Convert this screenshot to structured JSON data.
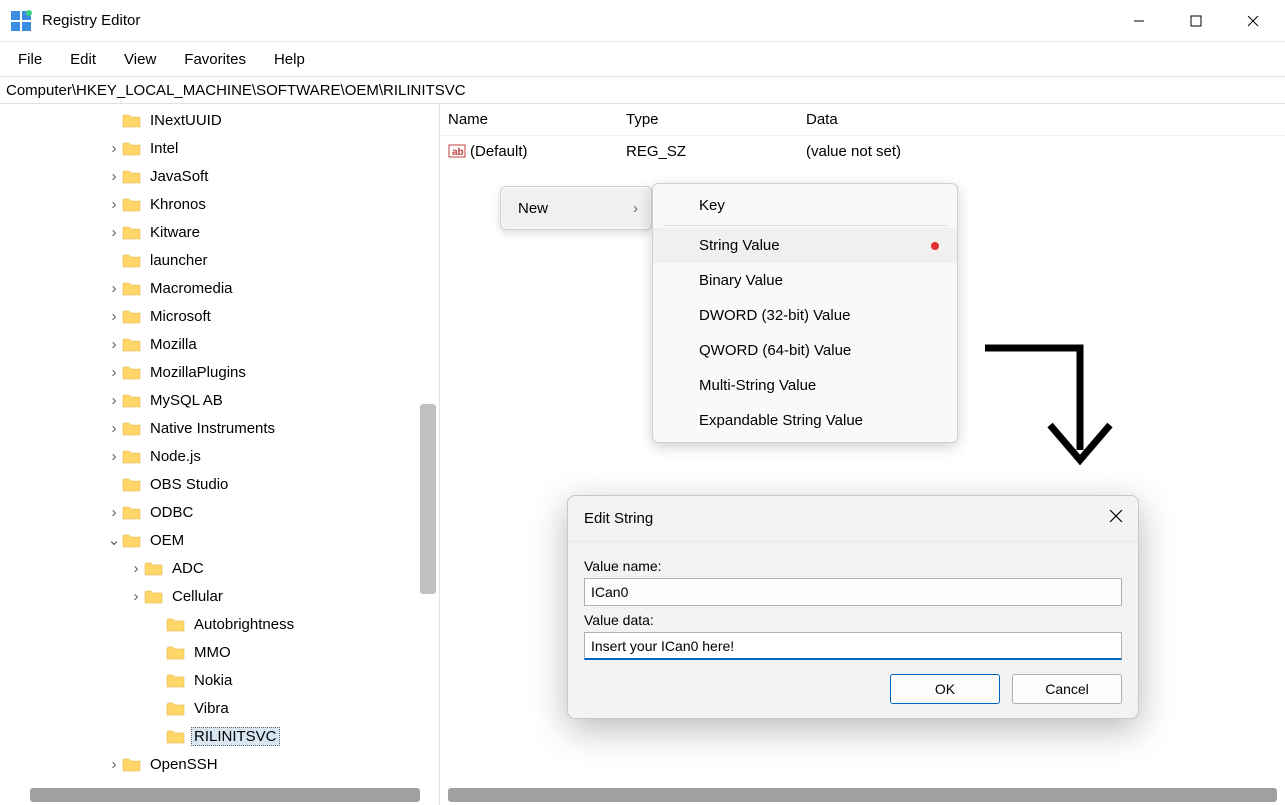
{
  "app": {
    "title": "Registry Editor"
  },
  "menu": {
    "file": "File",
    "edit": "Edit",
    "view": "View",
    "favorites": "Favorites",
    "help": "Help"
  },
  "addr": "Computer\\HKEY_LOCAL_MACHINE\\SOFTWARE\\OEM\\RILINITSVC",
  "tree": {
    "items": [
      {
        "label": "INextUUID",
        "indent": 3,
        "tw": ""
      },
      {
        "label": "Intel",
        "indent": 3,
        "tw": ">"
      },
      {
        "label": "JavaSoft",
        "indent": 3,
        "tw": ">"
      },
      {
        "label": "Khronos",
        "indent": 3,
        "tw": ">"
      },
      {
        "label": "Kitware",
        "indent": 3,
        "tw": ">"
      },
      {
        "label": "launcher",
        "indent": 3,
        "tw": ""
      },
      {
        "label": "Macromedia",
        "indent": 3,
        "tw": ">"
      },
      {
        "label": "Microsoft",
        "indent": 3,
        "tw": ">"
      },
      {
        "label": "Mozilla",
        "indent": 3,
        "tw": ">"
      },
      {
        "label": "MozillaPlugins",
        "indent": 3,
        "tw": ">"
      },
      {
        "label": "MySQL AB",
        "indent": 3,
        "tw": ">"
      },
      {
        "label": "Native Instruments",
        "indent": 3,
        "tw": ">"
      },
      {
        "label": "Node.js",
        "indent": 3,
        "tw": ">"
      },
      {
        "label": "OBS Studio",
        "indent": 3,
        "tw": ""
      },
      {
        "label": "ODBC",
        "indent": 3,
        "tw": ">"
      },
      {
        "label": "OEM",
        "indent": 3,
        "tw": "v"
      },
      {
        "label": "ADC",
        "indent": 4,
        "tw": ">"
      },
      {
        "label": "Cellular",
        "indent": 4,
        "tw": ">"
      },
      {
        "label": "Autobrightness",
        "indent": 5,
        "tw": ""
      },
      {
        "label": "MMO",
        "indent": 5,
        "tw": ""
      },
      {
        "label": "Nokia",
        "indent": 5,
        "tw": ""
      },
      {
        "label": "Vibra",
        "indent": 5,
        "tw": ""
      },
      {
        "label": "RILINITSVC",
        "indent": 5,
        "tw": "",
        "selected": true
      },
      {
        "label": "OpenSSH",
        "indent": 3,
        "tw": ">"
      }
    ]
  },
  "values": {
    "cols": {
      "name": "Name",
      "type": "Type",
      "data": "Data"
    },
    "rows": [
      {
        "name": "(Default)",
        "type": "REG_SZ",
        "data": "(value not set)"
      }
    ]
  },
  "ctx1": {
    "new": "New"
  },
  "ctx2": {
    "key": "Key",
    "string": "String Value",
    "binary": "Binary Value",
    "dword": "DWORD (32-bit) Value",
    "qword": "QWORD (64-bit) Value",
    "multi": "Multi-String Value",
    "expand": "Expandable String Value"
  },
  "dialog": {
    "title": "Edit String",
    "vname_label": "Value name:",
    "vname": "ICan0",
    "vdata_label": "Value data:",
    "vdata": "Insert your ICan0 here!",
    "ok": "OK",
    "cancel": "Cancel"
  }
}
